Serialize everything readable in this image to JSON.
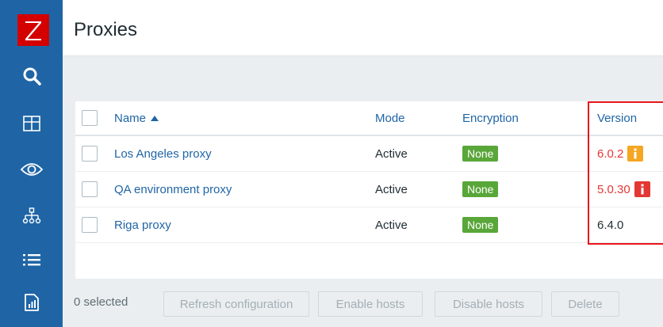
{
  "app": {
    "logo_letter": "Z"
  },
  "sidebar": {
    "items": [
      {
        "name": "search",
        "icon": "search-icon"
      },
      {
        "name": "dashboards",
        "icon": "dashboard-icon"
      },
      {
        "name": "monitoring",
        "icon": "eye-icon"
      },
      {
        "name": "services",
        "icon": "sitemap-icon"
      },
      {
        "name": "inventory",
        "icon": "list-icon"
      },
      {
        "name": "reports",
        "icon": "report-icon"
      }
    ]
  },
  "page": {
    "title": "Proxies"
  },
  "table": {
    "columns": {
      "name": "Name",
      "mode": "Mode",
      "encryption": "Encryption",
      "version": "Version"
    },
    "sort": {
      "column": "Name",
      "direction": "ascending"
    },
    "rows": [
      {
        "name": "Los Angeles proxy",
        "mode": "Active",
        "encryption": "None",
        "version": "6.0.2",
        "version_status": "warning"
      },
      {
        "name": "QA environment proxy",
        "mode": "Active",
        "encryption": "None",
        "version": "5.0.30",
        "version_status": "error"
      },
      {
        "name": "Riga proxy",
        "mode": "Active",
        "encryption": "None",
        "version": "6.4.0",
        "version_status": "ok"
      }
    ]
  },
  "footer": {
    "selected": "0 selected",
    "buttons": {
      "refresh": "Refresh configuration",
      "enable": "Enable hosts",
      "disable": "Disable hosts",
      "delete": "Delete"
    }
  },
  "colors": {
    "sidebar": "#1f65a6",
    "logo": "#d40000",
    "link": "#1f65a6",
    "badge_none": "#59a639",
    "version_warn": "#f5a623",
    "version_error": "#e33734",
    "highlight": "#e8161b"
  }
}
